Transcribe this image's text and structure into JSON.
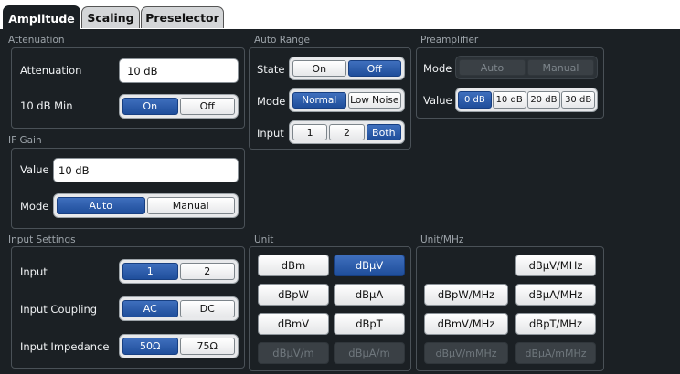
{
  "tabs": [
    "Amplitude",
    "Scaling",
    "Preselector"
  ],
  "attenuation": {
    "title": "Attenuation",
    "attenuation_label": "Attenuation",
    "attenuation_value": "10 dB",
    "min_label": "10 dB Min",
    "min_options": [
      "On",
      "Off"
    ]
  },
  "auto_range": {
    "title": "Auto Range",
    "state_label": "State",
    "state_options": [
      "On",
      "Off"
    ],
    "mode_label": "Mode",
    "mode_options": [
      "Normal",
      "Low Noise"
    ],
    "input_label": "Input",
    "input_options": [
      "1",
      "2",
      "Both"
    ]
  },
  "preamplifier": {
    "title": "Preamplifier",
    "mode_label": "Mode",
    "mode_options": [
      "Auto",
      "Manual"
    ],
    "value_label": "Value",
    "value_options": [
      "0 dB",
      "10 dB",
      "20 dB",
      "30 dB"
    ]
  },
  "if_gain": {
    "title": "IF Gain",
    "value_label": "Value",
    "value": "10 dB",
    "mode_label": "Mode",
    "mode_options": [
      "Auto",
      "Manual"
    ]
  },
  "input_settings": {
    "title": "Input Settings",
    "input_label": "Input",
    "input_options": [
      "1",
      "2"
    ],
    "coupling_label": "Input Coupling",
    "coupling_options": [
      "AC",
      "DC"
    ],
    "impedance_label": "Input Impedance",
    "impedance_options": [
      "50Ω",
      "75Ω"
    ]
  },
  "unit": {
    "title": "Unit",
    "buttons": [
      "dBm",
      "dBµV",
      "dBpW",
      "dBµA",
      "dBmV",
      "dBpT",
      "dBµV/m",
      "dBµA/m"
    ]
  },
  "unit_mhz": {
    "title": "Unit/MHz",
    "buttons": [
      "dBµV/MHz",
      "dBpW/MHz",
      "dBµA/MHz",
      "dBmV/MHz",
      "dBpT/MHz",
      "dBµV/mMHz",
      "dBµA/mMHz"
    ]
  },
  "colors": {
    "background": "#1b2024",
    "selected": "#2a5aa8",
    "group_border": "#4a5157"
  }
}
